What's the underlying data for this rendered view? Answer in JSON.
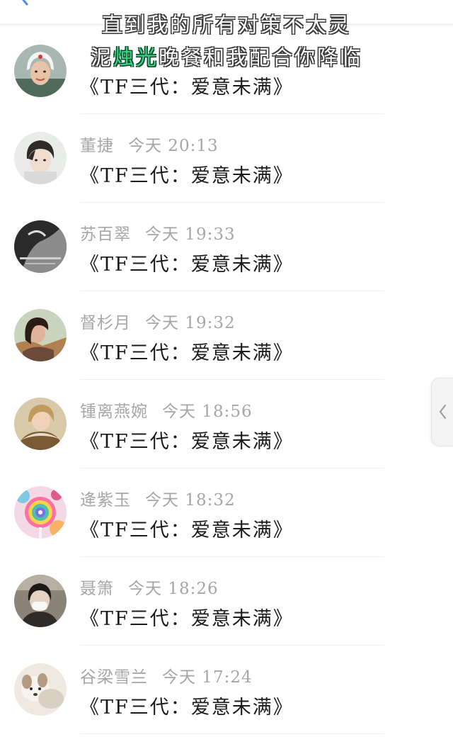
{
  "lyrics": {
    "line1": "直到我的所有对策不太灵",
    "line2_pre": "泥",
    "line2_highlight": "烛光",
    "line2_post": "晚餐和我配合你降临"
  },
  "message_list": [
    {
      "name": "",
      "time": "",
      "message": "《TF三代：爱意未满》",
      "avatar": "pilot-helmet-avatar"
    },
    {
      "name": "董捷",
      "time": "今天 20:13",
      "message": "《TF三代：爱意未满》",
      "avatar": "illustrated-boy-avatar"
    },
    {
      "name": "苏百翠",
      "time": "今天 19:33",
      "message": "《TF三代：爱意未满》",
      "avatar": "bw-smoking-avatar"
    },
    {
      "name": "督杉月",
      "time": "今天 19:32",
      "message": "《TF三代：爱意未满》",
      "avatar": "girl-portrait-avatar"
    },
    {
      "name": "锺离燕婉",
      "time": "今天 18:56",
      "message": "《TF三代：爱意未满》",
      "avatar": "fur-collar-avatar"
    },
    {
      "name": "逄紫玉",
      "time": "今天 18:32",
      "message": "《TF三代：爱意未满》",
      "avatar": "lollipop-avatar"
    },
    {
      "name": "聂箫",
      "time": "今天 18:26",
      "message": "《TF三代：爱意未满》",
      "avatar": "masked-person-avatar"
    },
    {
      "name": "谷梁雪兰",
      "time": "今天 17:24",
      "message": "《TF三代：爱意未满》",
      "avatar": "puppy-avatar"
    }
  ],
  "colors": {
    "name_gray": "#a6a6a6",
    "message_black": "#1b1b1b",
    "back_arrow_blue": "#4a90e2",
    "lyric_highlight_green": "#33d685"
  },
  "icons": {
    "back": "back-arrow-icon",
    "side_tab": "chevron-left-icon"
  }
}
